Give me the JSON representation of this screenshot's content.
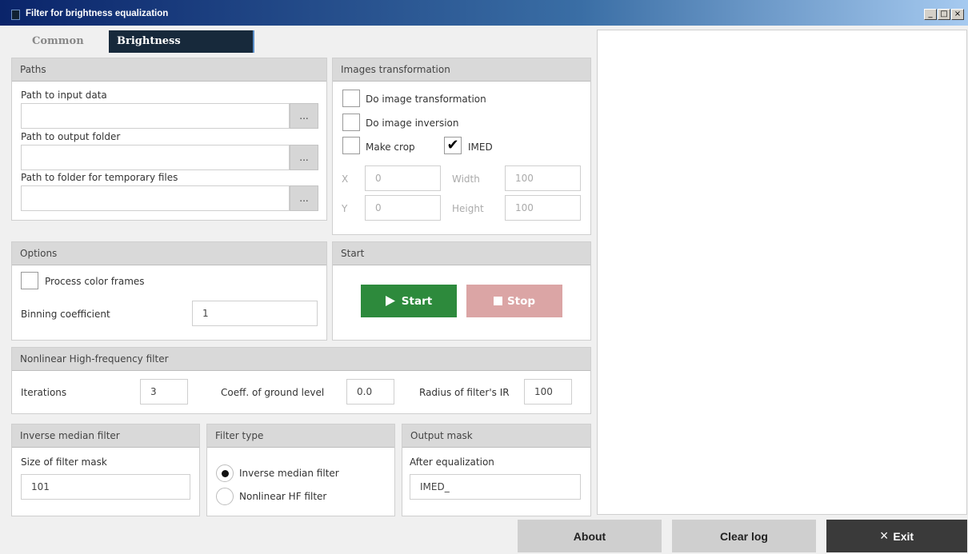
{
  "window": {
    "title": "Filter for brightness equalization",
    "controls": [
      "_",
      "□",
      "×"
    ]
  },
  "tabs": [
    {
      "label": "Common",
      "active": false
    },
    {
      "label": "Brightness equalization",
      "active": true
    }
  ],
  "paths": {
    "header": "Paths",
    "fields": [
      {
        "label": "Path to input data",
        "value": "",
        "browse": "..."
      },
      {
        "label": "Path to output folder",
        "value": "",
        "browse": "..."
      },
      {
        "label": "Path to folder for temporary files",
        "value": "",
        "browse": "..."
      }
    ]
  },
  "transform": {
    "header": "Images transformation",
    "do_transform": {
      "label": "Do image transformation",
      "checked": false
    },
    "do_inversion": {
      "label": "Do image inversion",
      "checked": false
    },
    "make_crop": {
      "label": "Make crop",
      "checked": false
    },
    "imed": {
      "label": "IMED",
      "checked": true,
      "mark": "✔"
    },
    "x": {
      "label": "X",
      "value": "0"
    },
    "y": {
      "label": "Y",
      "value": "0"
    },
    "width": {
      "label": "Width",
      "value": "100"
    },
    "height": {
      "label": "Height",
      "value": "100"
    }
  },
  "options": {
    "header": "Options",
    "process_color": {
      "label": "Process color frames",
      "checked": false
    },
    "binning": {
      "label": "Binning coefficient",
      "value": "1"
    }
  },
  "start": {
    "header": "Start",
    "start_label": "Start",
    "stop_label": "Stop",
    "start_icon": "play-icon",
    "stop_icon": "stop-square-icon",
    "start_color": "#2d8a3c",
    "stop_color": "#dba5a5"
  },
  "nonlinear": {
    "header": "Nonlinear High-frequency filter",
    "iterations": {
      "label": "Iterations",
      "value": "3"
    },
    "coeff": {
      "label": "Coeff. of ground level",
      "value": "0.0"
    },
    "radius": {
      "label": "Radius of filter's IR",
      "value": "100"
    }
  },
  "inverse_median": {
    "header": "Inverse median filter",
    "mask_label": "Size of filter mask",
    "mask_value": "101"
  },
  "filter_type": {
    "header": "Filter type",
    "options": [
      {
        "label": "Inverse median filter",
        "selected": true
      },
      {
        "label": "Nonlinear HF filter",
        "selected": false
      }
    ]
  },
  "output_mask": {
    "header": "Output mask",
    "after_label": "After equalization",
    "after_value": "IMED_"
  },
  "bottom": {
    "about": "About",
    "clear_log": "Clear log",
    "exit": "Exit",
    "exit_icon": "×"
  }
}
